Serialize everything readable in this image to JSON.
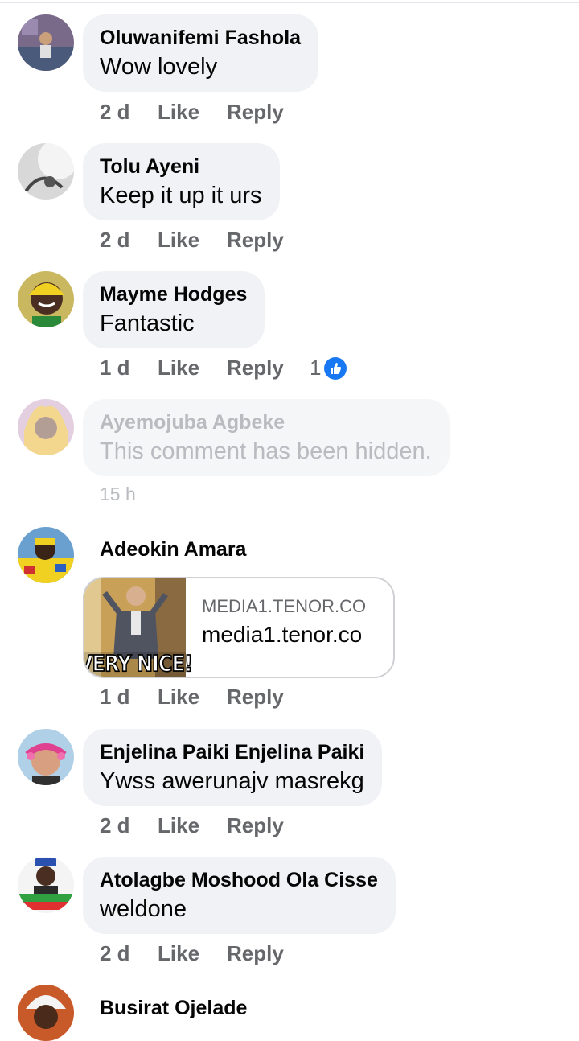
{
  "comments": [
    {
      "name": "Oluwanifemi Fashola",
      "text": "Wow lovely",
      "time": "2 d",
      "like": "Like",
      "reply": "Reply"
    },
    {
      "name": "Tolu Ayeni",
      "text": "Keep it up it urs",
      "time": "2 d",
      "like": "Like",
      "reply": "Reply"
    },
    {
      "name": "Mayme Hodges",
      "text": "Fantastic",
      "time": "1 d",
      "like": "Like",
      "reply": "Reply",
      "reaction_count": "1"
    },
    {
      "name": "Ayemojuba Agbeke",
      "text": "This comment has been hidden.",
      "time": "15 h"
    },
    {
      "name": "Adeokin Amara",
      "time": "1 d",
      "like": "Like",
      "reply": "Reply",
      "link": {
        "domain": "MEDIA1.TENOR.CO",
        "title": "media1.tenor.co",
        "thumb_caption": "VERY NICE!"
      }
    },
    {
      "name": "Enjelina Paiki Enjelina Paiki",
      "text": "Ywss awerunajv masrekg",
      "time": "2 d",
      "like": "Like",
      "reply": "Reply"
    },
    {
      "name": "Atolagbe Moshood Ola Cisse",
      "text": "weldone",
      "time": "2 d",
      "like": "Like",
      "reply": "Reply"
    },
    {
      "name": "Busirat Ojelade"
    }
  ],
  "colors": {
    "bubble": "#f0f2f5",
    "meta": "#65676b",
    "like_badge": "#1877f2"
  },
  "icons": {
    "reaction": "thumbs-up-icon"
  }
}
